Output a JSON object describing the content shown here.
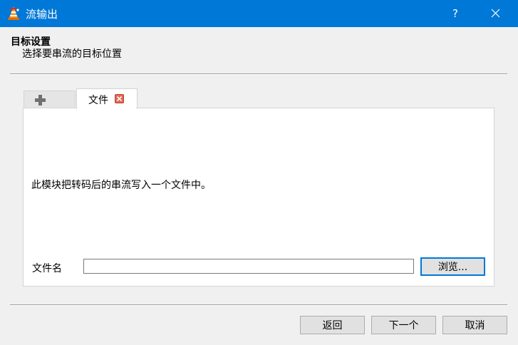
{
  "window": {
    "title": "流输出",
    "help_label": "?"
  },
  "header": {
    "title": "目标设置",
    "subtitle": "选择要串流的目标位置"
  },
  "tabs": [
    {
      "label": "",
      "icon": "plus-icon"
    },
    {
      "label": "文件",
      "icon": "close-icon",
      "active": true
    }
  ],
  "panel": {
    "description": "此模块把转码后的串流写入一个文件中。",
    "filename_label": "文件名",
    "filename_value": "",
    "browse_label": "浏览..."
  },
  "footer": {
    "back_label": "返回",
    "next_label": "下一个",
    "cancel_label": "取消"
  },
  "colors": {
    "titlebar": "#0078d7",
    "tab_close": "#e46a55",
    "focus_border": "#0078d7"
  }
}
